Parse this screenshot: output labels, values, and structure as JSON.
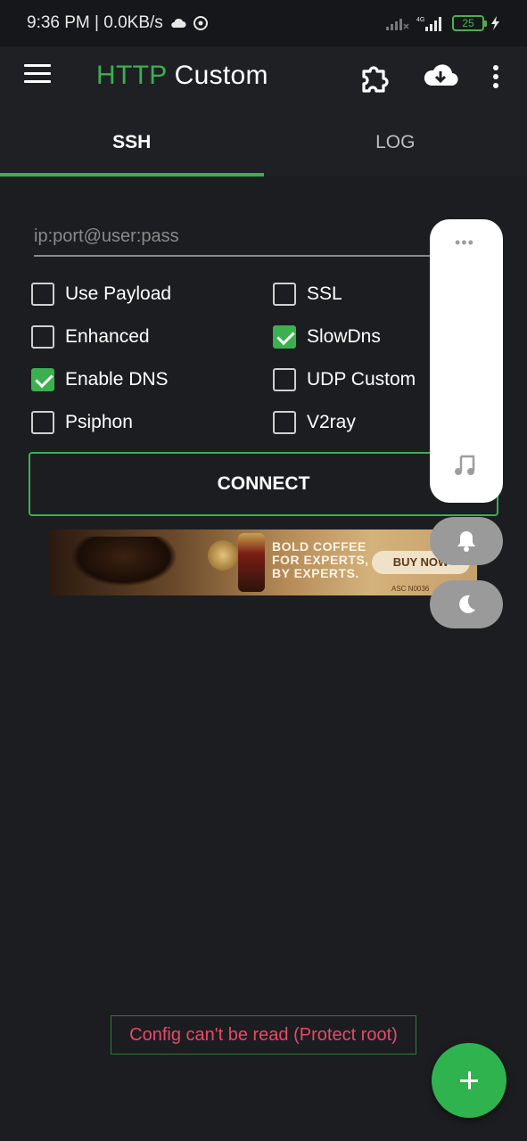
{
  "statusbar": {
    "time_text": "9:36 PM | 0.0KB/s",
    "battery": "25"
  },
  "appbar": {
    "title_part1": "HTTP",
    "title_part2": "Custom"
  },
  "tabs": [
    {
      "label": "SSH",
      "active": true
    },
    {
      "label": "LOG",
      "active": false
    }
  ],
  "host_input": {
    "placeholder": "ip:port@user:pass",
    "value": ""
  },
  "options": [
    {
      "label": "Use Payload",
      "checked": false
    },
    {
      "label": "SSL",
      "checked": false
    },
    {
      "label": "Enhanced",
      "checked": false
    },
    {
      "label": "SlowDns",
      "checked": true
    },
    {
      "label": "Enable DNS",
      "checked": true
    },
    {
      "label": "UDP Custom",
      "checked": false
    },
    {
      "label": "Psiphon",
      "checked": false
    },
    {
      "label": "V2ray",
      "checked": false
    }
  ],
  "connect_label": "CONNECT",
  "ad": {
    "line1": "BOLD COFFEE",
    "line2": "FOR EXPERTS,",
    "line3": "BY EXPERTS.",
    "button": "BUY NOW",
    "small": "ASC N0036"
  },
  "error_message": "Config can't be read (Protect root)",
  "colors": {
    "accent": "#3bb04f",
    "background": "#1c1d20",
    "error": "#e64a6a"
  }
}
